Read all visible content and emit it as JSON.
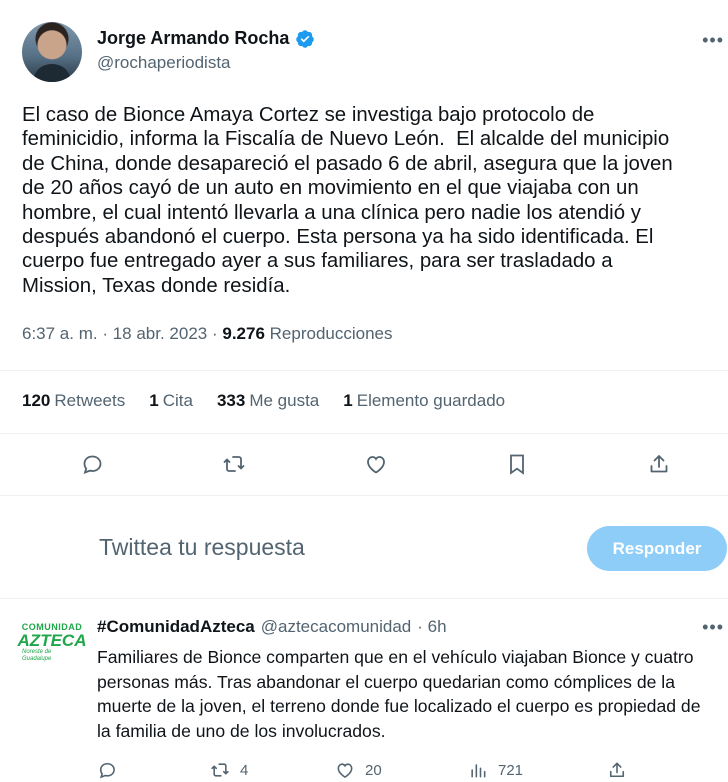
{
  "tweet": {
    "author_name": "Jorge Armando Rocha",
    "author_handle": "@rochaperiodista",
    "text": "El caso de Bionce Amaya Cortez se investiga bajo protocolo de\nfeminicidio, informa la Fiscalía de Nuevo León.  El alcalde del municipio\nde China, donde desapareció el pasado 6 de abril, asegura que la joven\nde 20 años cayó de un auto en movimiento en el que viajaba con un\nhombre, el cual intentó llevarla a una clínica pero nadie los atendió y\ndespués abandonó el cuerpo. Esta persona ya ha sido identificada. El\ncuerpo fue entregado ayer a sus familiares, para ser trasladado a\nMission, Texas donde residía.",
    "time": "6:37 a. m. · 18 abr. 2023 ·",
    "views_count": "9.276",
    "views_label": "Reproducciones"
  },
  "stats": {
    "retweets_count": "120",
    "retweets_label": "Retweets",
    "quotes_count": "1",
    "quotes_label": "Cita",
    "likes_count": "333",
    "likes_label": "Me gusta",
    "bookmarks_count": "1",
    "bookmarks_label": "Elemento guardado"
  },
  "actions": [
    "reply-icon",
    "retweet-icon",
    "like-icon",
    "bookmark-icon",
    "share-icon"
  ],
  "compose": {
    "placeholder": "Twittea tu respuesta",
    "button_label": "Responder"
  },
  "reply": {
    "logo_top": "COMUNIDAD",
    "logo_mid": "AZTECA",
    "logo_bot": "Noreste de Guadalupe",
    "author_name": "#ComunidadAzteca",
    "author_handle": "@aztecacomunidad",
    "time": "· 6h",
    "text": "Familiares de Bionce comparten que en el vehículo viajaban Bionce y cuatro personas más. Tras abandonar el cuerpo quedarian como cómplices de la muerte de la joven, el terreno donde fue localizado el cuerpo es propiedad de la familia de uno de los involucrados.",
    "retweets": "4",
    "likes": "20",
    "views": "721"
  },
  "colors": {
    "accent": "#1d9bf0",
    "button_disabled": "#8ecdf8",
    "secondary_text": "#536471",
    "logo_green": "#1fa64a"
  }
}
